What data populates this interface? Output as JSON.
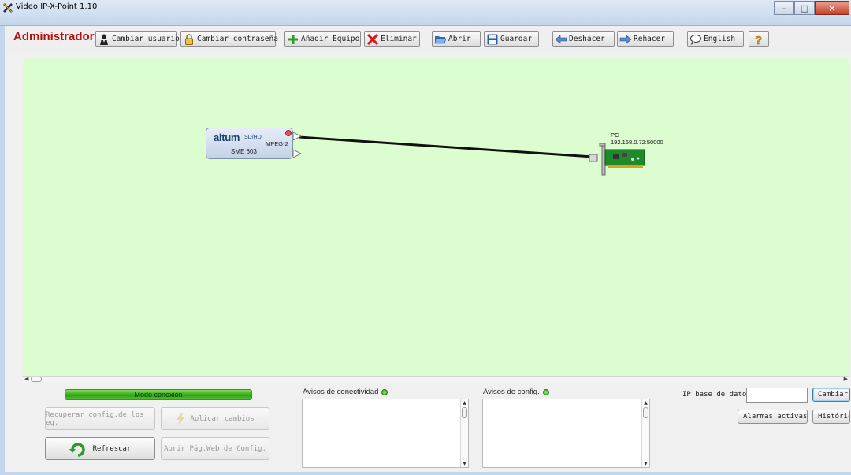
{
  "window": {
    "title": "Video IP-X-Point 1.10"
  },
  "toolbar": {
    "role": "Administrador",
    "buttons": [
      {
        "label": "Cambiar usuario",
        "icon": "user-icon"
      },
      {
        "label": "Cambiar contraseña",
        "icon": "lock-icon"
      },
      {
        "label": "Añadir Equipo",
        "icon": "plus-icon"
      },
      {
        "label": "Eliminar",
        "icon": "x-delete-icon"
      },
      {
        "label": "Abrir",
        "icon": "folder-open-icon"
      },
      {
        "label": "Guardar",
        "icon": "floppy-save-icon"
      },
      {
        "label": "Deshacer",
        "icon": "undo-arrow-icon"
      },
      {
        "label": "Rehacer",
        "icon": "redo-arrow-icon"
      },
      {
        "label": "English",
        "icon": "speech-bubble-icon"
      },
      {
        "label": "",
        "icon": "help-question-icon"
      }
    ]
  },
  "canvas": {
    "background": "#dcfdd0",
    "device": {
      "brand": "altum",
      "badge": "SD/HD",
      "codec": "MPEG-2",
      "model": "SME 603"
    },
    "target": {
      "name": "PC",
      "address": "192.168.0.72:50000"
    }
  },
  "bottom": {
    "mode": "Modo conexión",
    "buttons": {
      "recover": "Recuperar config.de los eq.",
      "apply": "Aplicar cambios",
      "refresh": "Refrescar",
      "webconfig": "Abrir Pág.Web de Config."
    },
    "connectivity_alerts_label": "Avisos de conectividad",
    "config_alerts_label": "Avisos de config.",
    "db_ip_label": "IP base de datos",
    "db_ip_value": "",
    "change": "Cambiar",
    "active_alarms": "Alarmas activas",
    "history": "Histórico"
  }
}
